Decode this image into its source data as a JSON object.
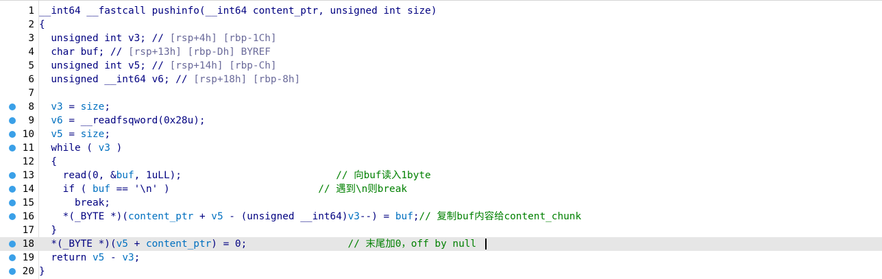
{
  "editor": {
    "caret_line": 18,
    "lines": [
      {
        "num": "1",
        "bp": false,
        "hl": false,
        "tokens": [
          {
            "t": "__int64 __fastcall pushinfo(__int64 content_ptr, unsigned int size)",
            "c": "n"
          }
        ]
      },
      {
        "num": "2",
        "bp": false,
        "hl": false,
        "tokens": [
          {
            "t": "{",
            "c": "n"
          }
        ]
      },
      {
        "num": "3",
        "bp": false,
        "hl": false,
        "tokens": [
          {
            "t": "  unsigned int v3; // ",
            "c": "n"
          },
          {
            "t": "[rsp+4h] [rbp-1Ch]",
            "c": "g"
          }
        ]
      },
      {
        "num": "4",
        "bp": false,
        "hl": false,
        "tokens": [
          {
            "t": "  char buf; // ",
            "c": "n"
          },
          {
            "t": "[rsp+13h] [rbp-Dh] BYREF",
            "c": "g"
          }
        ]
      },
      {
        "num": "5",
        "bp": false,
        "hl": false,
        "tokens": [
          {
            "t": "  unsigned int v5; // ",
            "c": "n"
          },
          {
            "t": "[rsp+14h] [rbp-Ch]",
            "c": "g"
          }
        ]
      },
      {
        "num": "6",
        "bp": false,
        "hl": false,
        "tokens": [
          {
            "t": "  unsigned __int64 v6; // ",
            "c": "n"
          },
          {
            "t": "[rsp+18h] [rbp-8h]",
            "c": "g"
          }
        ]
      },
      {
        "num": "7",
        "bp": false,
        "hl": false,
        "tokens": []
      },
      {
        "num": "8",
        "bp": true,
        "hl": false,
        "tokens": [
          {
            "t": "  ",
            "c": "n"
          },
          {
            "t": "v3",
            "c": "v"
          },
          {
            "t": " = ",
            "c": "n"
          },
          {
            "t": "size",
            "c": "v"
          },
          {
            "t": ";",
            "c": "n"
          }
        ]
      },
      {
        "num": "9",
        "bp": true,
        "hl": false,
        "tokens": [
          {
            "t": "  ",
            "c": "n"
          },
          {
            "t": "v6",
            "c": "v"
          },
          {
            "t": " = __readfsqword(0x28u);",
            "c": "n"
          }
        ]
      },
      {
        "num": "10",
        "bp": true,
        "hl": false,
        "tokens": [
          {
            "t": "  ",
            "c": "n"
          },
          {
            "t": "v5",
            "c": "v"
          },
          {
            "t": " = ",
            "c": "n"
          },
          {
            "t": "size",
            "c": "v"
          },
          {
            "t": ";",
            "c": "n"
          }
        ]
      },
      {
        "num": "11",
        "bp": true,
        "hl": false,
        "tokens": [
          {
            "t": "  while ( ",
            "c": "n"
          },
          {
            "t": "v3",
            "c": "v"
          },
          {
            "t": " )",
            "c": "n"
          }
        ]
      },
      {
        "num": "12",
        "bp": false,
        "hl": false,
        "tokens": [
          {
            "t": "  {",
            "c": "n"
          }
        ]
      },
      {
        "num": "13",
        "bp": true,
        "hl": false,
        "tokens": [
          {
            "t": "    read(0, &",
            "c": "n"
          },
          {
            "t": "buf",
            "c": "v"
          },
          {
            "t": ", 1uLL);",
            "c": "n"
          },
          {
            "t": "                          // 向buf读入1byte",
            "c": "c"
          }
        ]
      },
      {
        "num": "14",
        "bp": true,
        "hl": false,
        "tokens": [
          {
            "t": "    if ( ",
            "c": "n"
          },
          {
            "t": "buf",
            "c": "v"
          },
          {
            "t": " == '\\n' )",
            "c": "n"
          },
          {
            "t": "                         // 遇到\\n则break",
            "c": "c"
          }
        ]
      },
      {
        "num": "15",
        "bp": true,
        "hl": false,
        "tokens": [
          {
            "t": "      break;",
            "c": "n"
          }
        ]
      },
      {
        "num": "16",
        "bp": true,
        "hl": false,
        "tokens": [
          {
            "t": "    *(_BYTE *)(",
            "c": "n"
          },
          {
            "t": "content_ptr",
            "c": "v"
          },
          {
            "t": " + ",
            "c": "n"
          },
          {
            "t": "v5",
            "c": "v"
          },
          {
            "t": " - (unsigned __int64)",
            "c": "n"
          },
          {
            "t": "v3",
            "c": "v"
          },
          {
            "t": "--) = ",
            "c": "n"
          },
          {
            "t": "buf",
            "c": "v"
          },
          {
            "t": ";",
            "c": "n"
          },
          {
            "t": "// 复制buf内容给content_chunk",
            "c": "c"
          }
        ]
      },
      {
        "num": "17",
        "bp": false,
        "hl": false,
        "tokens": [
          {
            "t": "  }",
            "c": "n"
          }
        ]
      },
      {
        "num": "18",
        "bp": true,
        "hl": true,
        "tokens": [
          {
            "t": "  *(_BYTE *)(",
            "c": "n"
          },
          {
            "t": "v5",
            "c": "v"
          },
          {
            "t": " + ",
            "c": "n"
          },
          {
            "t": "content_ptr",
            "c": "v"
          },
          {
            "t": ") = 0;",
            "c": "n"
          },
          {
            "t": "                 // 末尾加0，off by null",
            "c": "c"
          }
        ]
      },
      {
        "num": "19",
        "bp": true,
        "hl": false,
        "tokens": [
          {
            "t": "  return ",
            "c": "n"
          },
          {
            "t": "v5",
            "c": "v"
          },
          {
            "t": " - ",
            "c": "n"
          },
          {
            "t": "v3",
            "c": "v"
          },
          {
            "t": ";",
            "c": "n"
          }
        ]
      },
      {
        "num": "20",
        "bp": true,
        "hl": false,
        "tokens": [
          {
            "t": "}",
            "c": "n"
          }
        ]
      }
    ]
  }
}
